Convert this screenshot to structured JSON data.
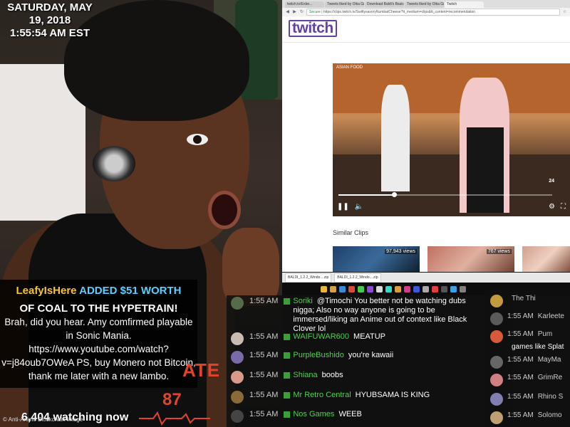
{
  "overlay": {
    "date": "SATURDAY, MAY 19, 2018",
    "time": "1:55:54 AM  EST",
    "viewers": "6,404 watching now",
    "watermark": "© Anti-Anime Blockchain Image",
    "hypetrain_label": "ATE",
    "hypetrain_level": "87"
  },
  "donation": {
    "user": "LeafyIsHere",
    "added_text": " ADDED ",
    "amount": "$51",
    "worth_text": " WORTH",
    "line2": "OF COAL TO THE HYPETRAIN!",
    "message": "Brah, did you hear. Amy comfirmed playable in Sonic Mania. https://www.youtube.com/watch?v=j84oub7OWeA PS, buy Monero not Bitcoin, thank me later with a new lambo."
  },
  "browser": {
    "tabs": [
      {
        "label": "twitch.tv/Enbe..."
      },
      {
        "label": "Tweets liked by Oika Gl..."
      },
      {
        "label": "Download Baldi's Basic..."
      },
      {
        "label": "Tweets liked by Oika Gl..."
      },
      {
        "label": "Twitch"
      }
    ],
    "secure_label": "Secure",
    "url": "https://clips.twitch.tv/SwiftysavoryNumbatCheese?tt_medium=clips&tt_content=recommendation",
    "logo": "twitch",
    "player": {
      "video_title": "ASIAN FOOD",
      "counter": "24",
      "progress": 0.26
    },
    "similar_heading": "Similar Clips",
    "thumbs": [
      {
        "views": "97,943 views"
      },
      {
        "views": "767 views"
      },
      {
        "views": ""
      }
    ]
  },
  "taskbar": {
    "items": [
      {
        "label": "BALDI_1.2.2_Windo....zip"
      },
      {
        "label": "BALDI_1.2.2_Windo....zip"
      }
    ]
  },
  "chat": [
    {
      "time": "1:55 AM",
      "user": "Soriki",
      "text": "@Timochi You better not be watching dubs nigga; Also no way anyone is going to be immersed/liking an Anime out of context like Black Clover lol",
      "avatar": "#556b4a"
    },
    {
      "time": "1:55 AM",
      "user": "WAIFUWAR600",
      "text": "MEATUP",
      "avatar": "#c8bcb2"
    },
    {
      "time": "1:55 AM",
      "user": "PurpleBushido",
      "text": "you're kawaii",
      "avatar": "#7a6aa8"
    },
    {
      "time": "1:55 AM",
      "user": "Shiana",
      "text": "boobs",
      "avatar": "#d99a8a"
    },
    {
      "time": "1:55 AM",
      "user": "Mr Retro Central",
      "text": "HYUBSAMA IS KING",
      "avatar": "#8b6a3a"
    },
    {
      "time": "1:55 AM",
      "user": "Nos Games",
      "text": "WEEB",
      "avatar": "#444444"
    }
  ],
  "chat2": [
    {
      "time": "",
      "user": "The Thi",
      "text": "",
      "avatar": "#c29a40"
    },
    {
      "time": "1:55 AM",
      "user": "Karleete",
      "text": "",
      "avatar": "#5a5a5a"
    },
    {
      "time": "1:55 AM",
      "user": "Pum",
      "text": "games like Splat",
      "avatar": "#d45a3a"
    },
    {
      "time": "1:55 AM",
      "user": "MayMa",
      "text": "",
      "avatar": "#666666"
    },
    {
      "time": "1:55 AM",
      "user": "GrimRe",
      "text": "",
      "avatar": "#d08080"
    },
    {
      "time": "1:55 AM",
      "user": "Rhino S",
      "text": "",
      "avatar": "#8080b0"
    },
    {
      "time": "1:55 AM",
      "user": "Solomo",
      "text": "",
      "avatar": "#c0a070"
    }
  ]
}
